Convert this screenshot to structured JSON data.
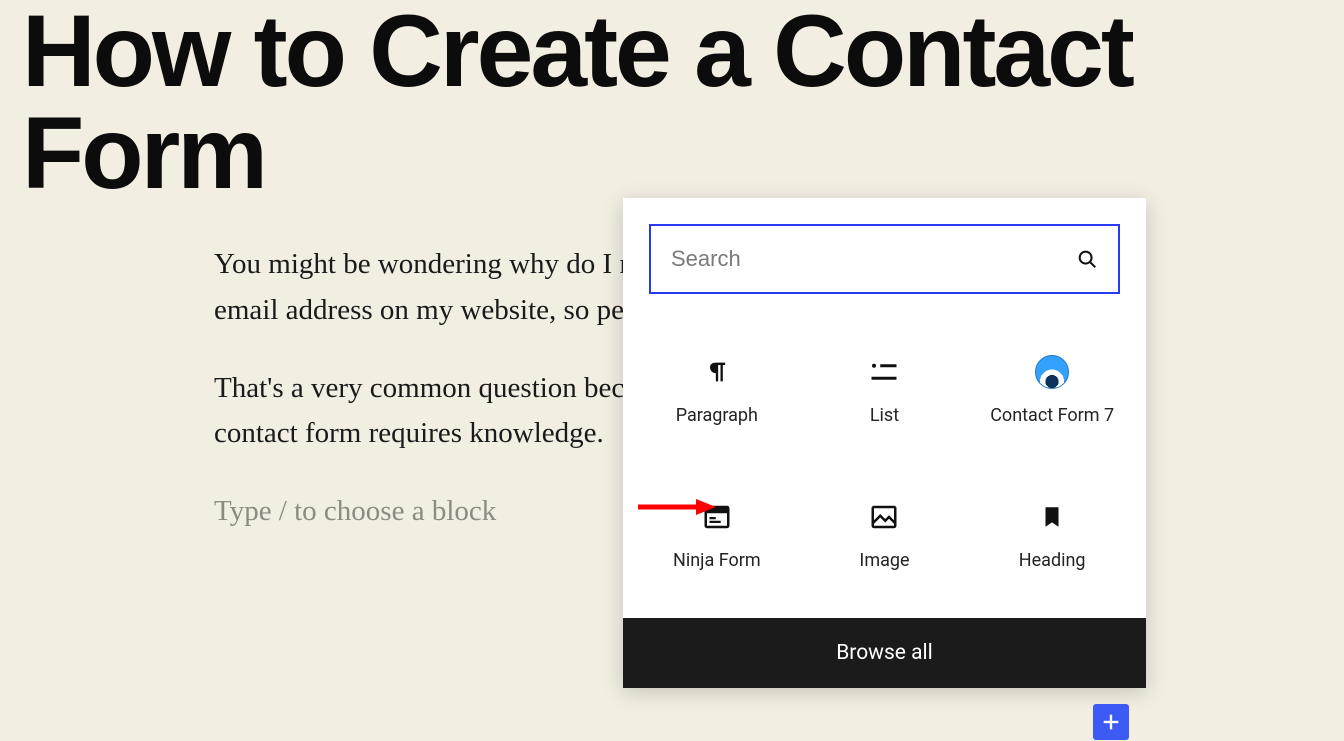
{
  "title": "How to Create a Contact Form",
  "paragraphs": [
    "You might be wondering why do I need a contact form? Can't I just add my email address on my website, so people can email me?",
    "That's a very common question because beginners are afraid that adding a contact form requires knowledge."
  ],
  "block_placeholder": "Type / to choose a block",
  "inserter": {
    "search_placeholder": "Search",
    "browse_all": "Browse all",
    "blocks": [
      {
        "label": "Paragraph",
        "icon": "paragraph"
      },
      {
        "label": "List",
        "icon": "list"
      },
      {
        "label": "Contact Form 7",
        "icon": "cf7"
      },
      {
        "label": "Ninja Form",
        "icon": "ninja"
      },
      {
        "label": "Image",
        "icon": "image"
      },
      {
        "label": "Heading",
        "icon": "heading"
      }
    ]
  },
  "colors": {
    "page_bg": "#f2eee2",
    "accent": "#3b5bf4",
    "focus": "#2a3af0",
    "arrow": "#ff0000"
  }
}
